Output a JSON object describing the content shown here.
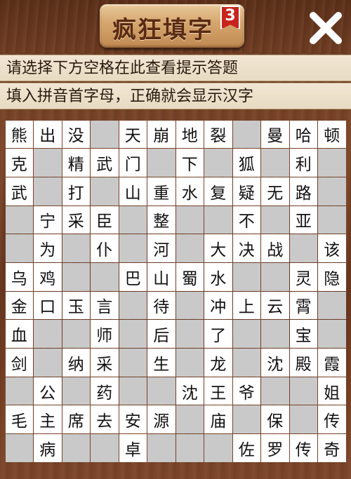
{
  "header": {
    "title": "疯狂填字",
    "level": "3"
  },
  "hints": {
    "line1": "请选择下方空格在此查看提示答题",
    "line2": "填入拼音首字母，正确就会显示汉字"
  },
  "grid": {
    "cols": 12,
    "rows": [
      [
        [
          "w",
          "熊"
        ],
        [
          "w",
          "出"
        ],
        [
          "w",
          "没"
        ],
        [
          "g",
          ""
        ],
        [
          "w",
          "天"
        ],
        [
          "w",
          "崩"
        ],
        [
          "w",
          "地"
        ],
        [
          "w",
          "裂"
        ],
        [
          "g",
          ""
        ],
        [
          "w",
          "曼"
        ],
        [
          "w",
          "哈"
        ],
        [
          "w",
          "顿"
        ]
      ],
      [
        [
          "w",
          "克"
        ],
        [
          "g",
          ""
        ],
        [
          "w",
          "精"
        ],
        [
          "w",
          "武"
        ],
        [
          "w",
          "门"
        ],
        [
          "g",
          ""
        ],
        [
          "w",
          "下"
        ],
        [
          "g",
          ""
        ],
        [
          "w",
          "狐"
        ],
        [
          "g",
          ""
        ],
        [
          "w",
          "利"
        ],
        [
          "g",
          ""
        ]
      ],
      [
        [
          "w",
          "武"
        ],
        [
          "g",
          ""
        ],
        [
          "w",
          "打"
        ],
        [
          "g",
          ""
        ],
        [
          "w",
          "山"
        ],
        [
          "w",
          "重"
        ],
        [
          "w",
          "水"
        ],
        [
          "w",
          "复"
        ],
        [
          "w",
          "疑"
        ],
        [
          "w",
          "无"
        ],
        [
          "w",
          "路"
        ],
        [
          "g",
          ""
        ]
      ],
      [
        [
          "g",
          ""
        ],
        [
          "w",
          "宁"
        ],
        [
          "w",
          "采"
        ],
        [
          "w",
          "臣"
        ],
        [
          "g",
          ""
        ],
        [
          "w",
          "整"
        ],
        [
          "g",
          ""
        ],
        [
          "g",
          ""
        ],
        [
          "w",
          "不"
        ],
        [
          "g",
          ""
        ],
        [
          "w",
          "亚"
        ],
        [
          "g",
          ""
        ]
      ],
      [
        [
          "g",
          ""
        ],
        [
          "w",
          "为"
        ],
        [
          "g",
          ""
        ],
        [
          "w",
          "仆"
        ],
        [
          "g",
          ""
        ],
        [
          "w",
          "河"
        ],
        [
          "g",
          ""
        ],
        [
          "w",
          "大"
        ],
        [
          "w",
          "决"
        ],
        [
          "w",
          "战"
        ],
        [
          "g",
          ""
        ],
        [
          "w",
          "该"
        ]
      ],
      [
        [
          "w",
          "乌"
        ],
        [
          "w",
          "鸡"
        ],
        [
          "g",
          ""
        ],
        [
          "g",
          ""
        ],
        [
          "w",
          "巴"
        ],
        [
          "w",
          "山"
        ],
        [
          "w",
          "蜀"
        ],
        [
          "w",
          "水"
        ],
        [
          "g",
          ""
        ],
        [
          "g",
          ""
        ],
        [
          "w",
          "灵"
        ],
        [
          "w",
          "隐"
        ]
      ],
      [
        [
          "w",
          "金"
        ],
        [
          "w",
          "口"
        ],
        [
          "w",
          "玉"
        ],
        [
          "w",
          "言"
        ],
        [
          "g",
          ""
        ],
        [
          "w",
          "待"
        ],
        [
          "g",
          ""
        ],
        [
          "w",
          "冲"
        ],
        [
          "w",
          "上"
        ],
        [
          "w",
          "云"
        ],
        [
          "w",
          "霄"
        ],
        [
          "g",
          ""
        ]
      ],
      [
        [
          "w",
          "血"
        ],
        [
          "g",
          ""
        ],
        [
          "g",
          ""
        ],
        [
          "w",
          "师"
        ],
        [
          "g",
          ""
        ],
        [
          "w",
          "后"
        ],
        [
          "g",
          ""
        ],
        [
          "w",
          "了"
        ],
        [
          "g",
          ""
        ],
        [
          "g",
          ""
        ],
        [
          "w",
          "宝"
        ],
        [
          "g",
          ""
        ]
      ],
      [
        [
          "w",
          "剑"
        ],
        [
          "g",
          ""
        ],
        [
          "w",
          "纳"
        ],
        [
          "w",
          "采"
        ],
        [
          "g",
          ""
        ],
        [
          "w",
          "生"
        ],
        [
          "g",
          ""
        ],
        [
          "w",
          "龙"
        ],
        [
          "g",
          ""
        ],
        [
          "w",
          "沈"
        ],
        [
          "w",
          "殿"
        ],
        [
          "w",
          "霞"
        ]
      ],
      [
        [
          "g",
          ""
        ],
        [
          "w",
          "公"
        ],
        [
          "g",
          ""
        ],
        [
          "w",
          "药"
        ],
        [
          "g",
          ""
        ],
        [
          "g",
          ""
        ],
        [
          "w",
          "沈"
        ],
        [
          "w",
          "王"
        ],
        [
          "w",
          "爷"
        ],
        [
          "g",
          ""
        ],
        [
          "g",
          ""
        ],
        [
          "w",
          "姐"
        ]
      ],
      [
        [
          "w",
          "毛"
        ],
        [
          "w",
          "主"
        ],
        [
          "w",
          "席"
        ],
        [
          "w",
          "去"
        ],
        [
          "w",
          "安"
        ],
        [
          "w",
          "源"
        ],
        [
          "g",
          ""
        ],
        [
          "w",
          "庙"
        ],
        [
          "g",
          ""
        ],
        [
          "w",
          "保"
        ],
        [
          "g",
          ""
        ],
        [
          "w",
          "传"
        ]
      ],
      [
        [
          "g",
          ""
        ],
        [
          "w",
          "病"
        ],
        [
          "g",
          ""
        ],
        [
          "g",
          ""
        ],
        [
          "w",
          "卓"
        ],
        [
          "g",
          ""
        ],
        [
          "g",
          ""
        ],
        [
          "g",
          ""
        ],
        [
          "w",
          "佐"
        ],
        [
          "w",
          "罗"
        ],
        [
          "w",
          "传"
        ],
        [
          "w",
          "奇"
        ]
      ]
    ]
  },
  "icons": {
    "close": "close-icon"
  }
}
